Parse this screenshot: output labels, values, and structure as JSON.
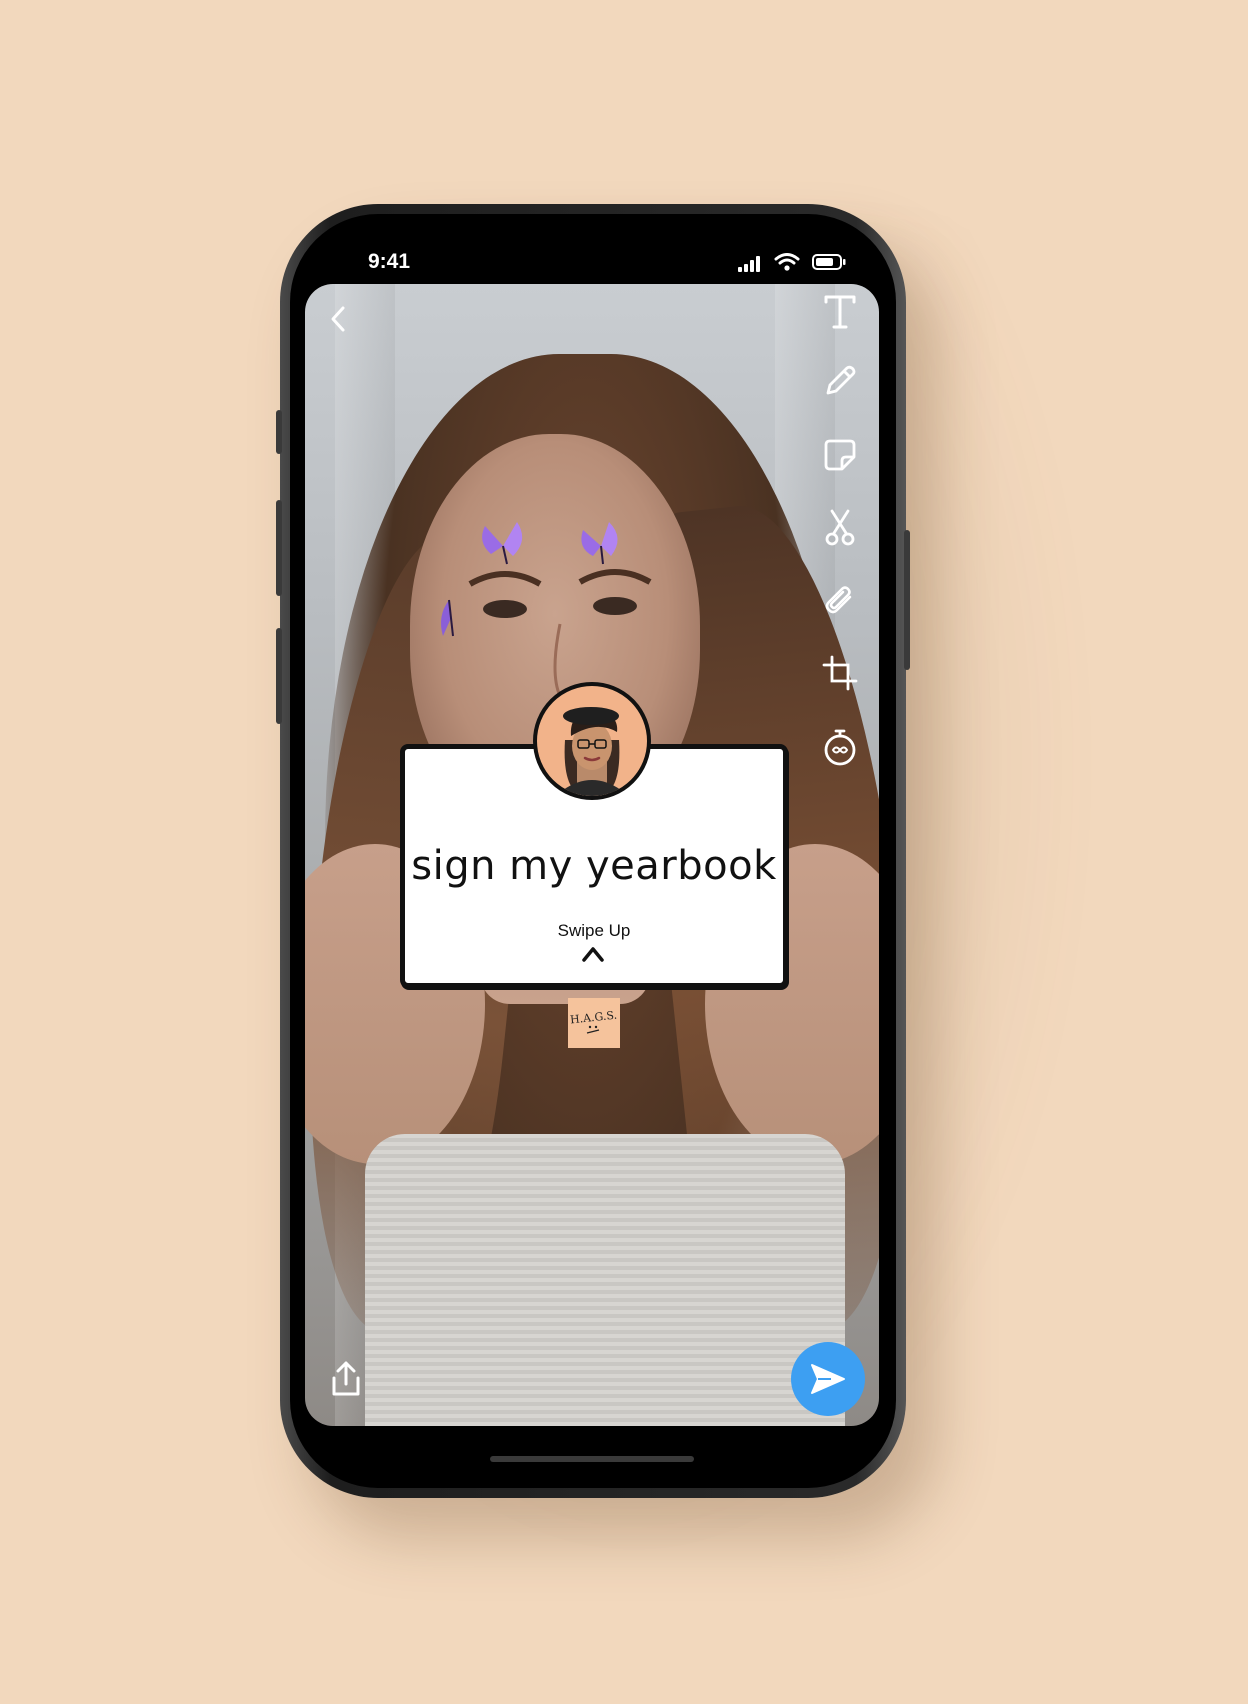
{
  "status": {
    "time": "9:41"
  },
  "story": {
    "sticker_title": "sign my yearbook",
    "swipe_label": "Swipe Up",
    "note_text": "H.A.G.S."
  },
  "toolbar": {
    "tools": [
      "text-tool",
      "pen-tool",
      "sticker-tool",
      "scissors-tool",
      "attach-tool",
      "crop-tool",
      "timer-tool"
    ]
  },
  "colors": {
    "background": "#f2d8bd",
    "send": "#3d9ff2",
    "butterfly": "#9a6ce6"
  }
}
